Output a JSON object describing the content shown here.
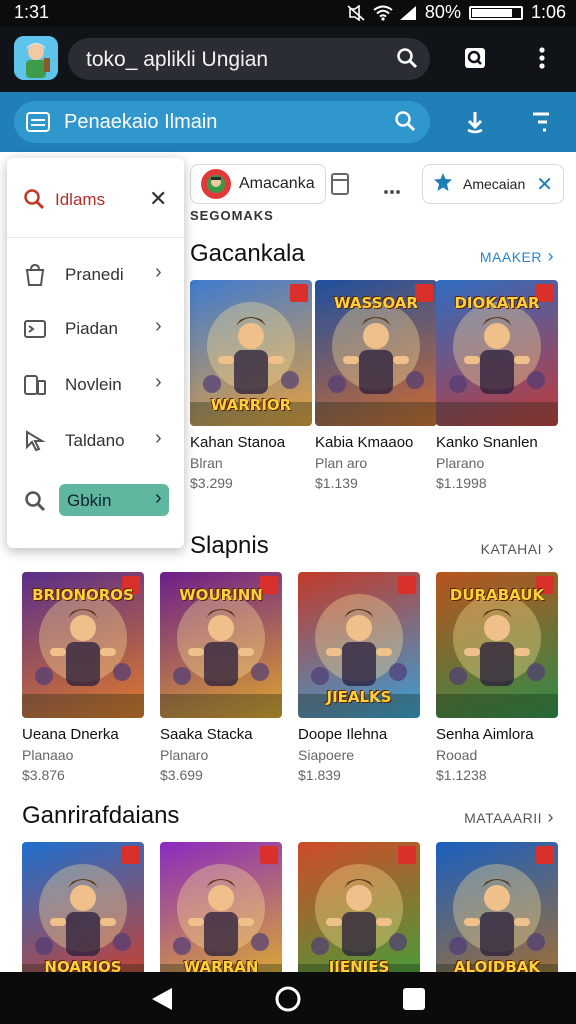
{
  "status_bar": {
    "time_left": "1:31",
    "battery": "80%",
    "time_right": "1:06"
  },
  "browser": {
    "url": "toko_ aplikli Ungian",
    "icons": [
      "search-icon",
      "tabs-icon",
      "more-vert-icon"
    ]
  },
  "search_bar": {
    "text": "Penaekaio Ilmain",
    "icons": [
      "menu-icon",
      "search-icon",
      "download-icon",
      "filter-icon"
    ]
  },
  "chips": {
    "chip1": "Amacanka",
    "chip2": "Amecaian",
    "strip_text": "SEGOMAKS"
  },
  "dropdown": {
    "header": "Idlams",
    "items": [
      {
        "label": "Pranedi",
        "icon": "bag-icon"
      },
      {
        "label": "Piadan",
        "icon": "terminal-icon"
      },
      {
        "label": "Novlein",
        "icon": "devices-icon"
      },
      {
        "label": "Taldano",
        "icon": "cursor-icon"
      },
      {
        "label": "Gbkin",
        "icon": "search-icon",
        "active": true
      }
    ]
  },
  "sections": [
    {
      "title": "Gacankala",
      "more": "MAAKER",
      "more_color": "#2a86c8",
      "cards": [
        {
          "name": "Kahan Stanoa",
          "sub": "Blran",
          "price": "$3.299",
          "art": "WARRIOR",
          "colors": [
            "#3f7bd1",
            "#e8a03a"
          ]
        },
        {
          "name": "Kabia Kmaaoo",
          "sub": "Plan aro",
          "price": "$1.139",
          "art": "WASSOAR",
          "colors": [
            "#1d4fa0",
            "#d16b2f"
          ]
        },
        {
          "name": "Kanko Snanlen",
          "sub": "Plarano",
          "price": "$1.1998",
          "art": "DIOKATAR",
          "colors": [
            "#2f6cc0",
            "#c23a3a"
          ]
        }
      ]
    },
    {
      "title": "Slapnis",
      "more": "KATAHAI",
      "more_color": "#555555",
      "cards": [
        {
          "name": "Ueana Dnerka",
          "sub": "Planaao",
          "price": "$3.876",
          "art": "BRIONOROS",
          "colors": [
            "#5a2e8a",
            "#e07b2a"
          ]
        },
        {
          "name": "Saaka Stacka",
          "sub": "Planaro",
          "price": "$3.699",
          "art": "WOURINN",
          "colors": [
            "#6b1e8c",
            "#e0a52e"
          ]
        },
        {
          "name": "Doope Ilehna",
          "sub": "Siapoere",
          "price": "$1.839",
          "art": "JIEALKS",
          "colors": [
            "#c23a2a",
            "#3aa0d8"
          ]
        },
        {
          "name": "Senha Aimlora",
          "sub": "Rooad",
          "price": "$1.1238",
          "art": "DURABAUK",
          "colors": [
            "#b8531e",
            "#2f8d4a"
          ]
        }
      ]
    },
    {
      "title": "Ganrirafdaians",
      "more": "MATAAARII",
      "more_color": "#555555",
      "cards": [
        {
          "name": "",
          "sub": "",
          "price": "",
          "art": "NOARIOS",
          "colors": [
            "#1e6fd0",
            "#d0402a"
          ]
        },
        {
          "name": "",
          "sub": "",
          "price": "",
          "art": "WARRAN",
          "colors": [
            "#8a2ac0",
            "#e0b02a"
          ]
        },
        {
          "name": "",
          "sub": "",
          "price": "",
          "art": "JIENIES",
          "colors": [
            "#d04a2a",
            "#3fa23a"
          ]
        },
        {
          "name": "",
          "sub": "",
          "price": "",
          "art": "ALOIDBAK",
          "colors": [
            "#1a5fbf",
            "#a8702e"
          ]
        }
      ]
    }
  ],
  "nav": [
    "back-icon",
    "home-icon",
    "recents-icon"
  ]
}
